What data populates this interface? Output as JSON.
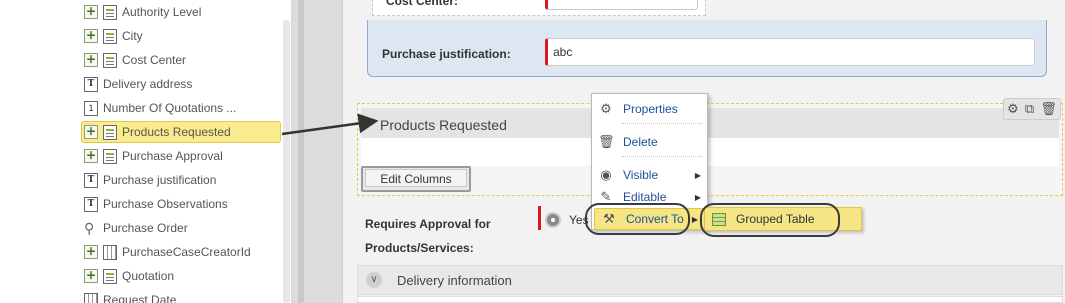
{
  "tree": {
    "items": [
      {
        "label": "Authority Level",
        "icon": "table-icon",
        "expandable": true
      },
      {
        "label": "City",
        "icon": "table-icon",
        "expandable": true
      },
      {
        "label": "Cost Center",
        "icon": "table-icon",
        "expandable": true
      },
      {
        "label": "Delivery address",
        "icon": "text-field-icon",
        "expandable": false
      },
      {
        "label": "Number Of Quotations ...",
        "icon": "number-field-icon",
        "expandable": false
      },
      {
        "label": "Products Requested",
        "icon": "table-icon",
        "expandable": true,
        "selected": true
      },
      {
        "label": "Purchase Approval",
        "icon": "table-icon",
        "expandable": true
      },
      {
        "label": "Purchase justification",
        "icon": "text-field-icon",
        "expandable": false
      },
      {
        "label": "Purchase Observations",
        "icon": "text-field-icon",
        "expandable": false
      },
      {
        "label": "Purchase Order",
        "icon": "paperclip-icon",
        "expandable": false
      },
      {
        "label": "PurchaseCaseCreatorId",
        "icon": "grid-icon",
        "expandable": true
      },
      {
        "label": "Quotation",
        "icon": "table-icon",
        "expandable": true
      },
      {
        "label": "Request Date",
        "icon": "date-icon",
        "expandable": false
      }
    ]
  },
  "form": {
    "cost_center_label": "Cost Center:",
    "justification_label": "Purchase justification:",
    "justification_value": "abc",
    "grid_title": "Products Requested",
    "edit_columns_label": "Edit Columns",
    "requires_approval_line1": "Requires Approval for",
    "requires_approval_line2": "Products/Services:",
    "requires_approval_option": "Yes",
    "delivery_title": "Delivery information"
  },
  "section_tools": [
    "gear-icon",
    "convert-icon",
    "trash-icon"
  ],
  "context_menu": {
    "items": [
      {
        "label": "Properties",
        "icon": "gear-icon",
        "submenu": false
      },
      {
        "label": "Delete",
        "icon": "trash-icon",
        "submenu": false
      },
      {
        "label": "Visible",
        "icon": "eye-icon",
        "submenu": true
      },
      {
        "label": "Editable",
        "icon": "edit-icon",
        "submenu": true
      },
      {
        "label": "Convert To",
        "icon": "convert-icon",
        "submenu": true,
        "highlighted": true
      }
    ],
    "submenu": {
      "label": "Grouped Table",
      "icon": "grouped-table-icon"
    }
  },
  "colors": {
    "highlight": "#f6e584",
    "required_bar": "#d71920",
    "menu_text": "#1f4e9a",
    "panel_blue": "#dde6f1"
  }
}
